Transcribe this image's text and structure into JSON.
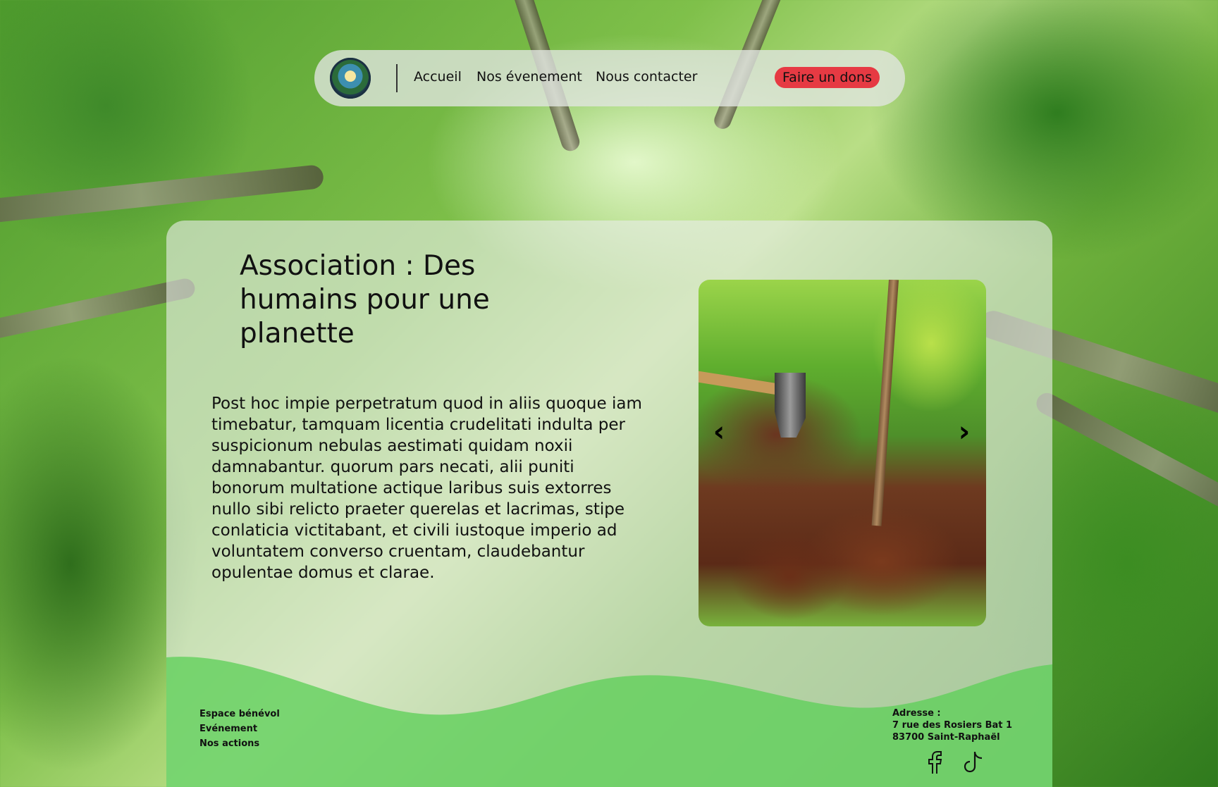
{
  "navbar": {
    "logo_alt": "Association logo",
    "links": [
      "Accueil",
      "Nos évenement",
      "Nous contacter"
    ],
    "donate_label": "Faire un dons",
    "donate_color": "#e63a43"
  },
  "main": {
    "title": "Association : Des humains pour une planette",
    "body": "Post hoc impie perpetratum quod in aliis quoque iam timebatur, tamquam licentia crudelitati indulta per suspicionum nebulas aestimati quidam noxii damnabantur. quorum pars necati, alii puniti bonorum multatione actique laribus suis extorres nullo sibi relicto praeter querelas et lacrimas, stipe conlaticia victitabant, et civili iustoque imperio ad voluntatem converso cruentam, claudebantur opulentae domus et clarae.",
    "carousel": {
      "prev_icon": "chevron-left-icon",
      "next_icon": "chevron-right-icon"
    }
  },
  "footer": {
    "links": [
      "Espace bénévol",
      "Evénement",
      "Nos actions"
    ],
    "address_label": "Adresse :",
    "address_line1": "7 rue des Rosiers Bat 1",
    "address_line2": "83700 Saint-Raphaël",
    "social_icons": [
      "facebook-icon",
      "tiktok-icon"
    ],
    "wave_color": "#5fcf5a"
  }
}
